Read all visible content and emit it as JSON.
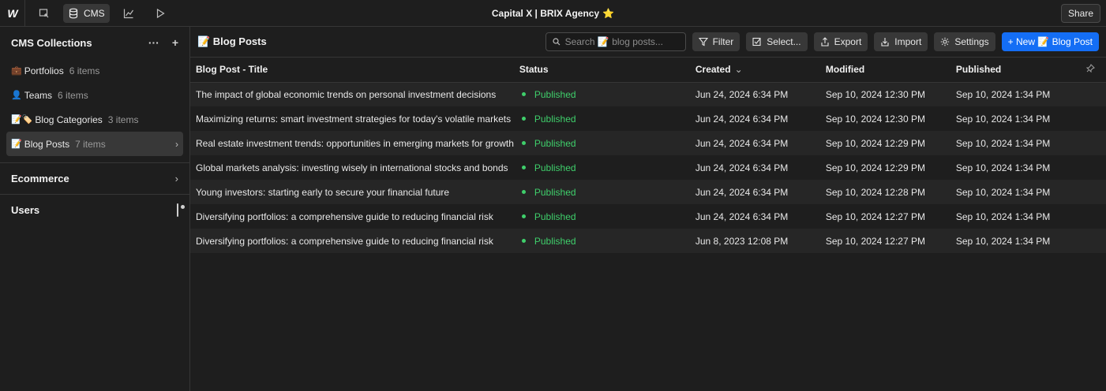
{
  "topbar": {
    "logo": "W",
    "cms_label": "CMS",
    "site_title": "Capital X | BRIX Agency",
    "star": "⭐",
    "share_label": "Share"
  },
  "sidebar": {
    "title": "CMS Collections",
    "more_glyph": "···",
    "add_glyph": "+",
    "collections": [
      {
        "emoji": "💼",
        "name": "Portfolios",
        "count": "6 items"
      },
      {
        "emoji": "👤",
        "name": "Teams",
        "count": "6 items"
      },
      {
        "emoji": "📝🏷️",
        "name": "Blog Categories",
        "count": "3 items"
      },
      {
        "emoji": "📝",
        "name": "Blog Posts",
        "count": "7 items"
      }
    ],
    "ecommerce_label": "Ecommerce",
    "users_label": "Users"
  },
  "main": {
    "title": "📝 Blog Posts",
    "search_placeholder": "Search 📝 blog posts...",
    "filter_label": "Filter",
    "select_label": "Select...",
    "export_label": "Export",
    "import_label": "Import",
    "settings_label": "Settings",
    "new_label": "+ New 📝 Blog Post"
  },
  "table": {
    "columns": [
      "Blog Post - Title",
      "Status",
      "Created",
      "Modified",
      "Published"
    ],
    "rows": [
      {
        "title": "The impact of global economic trends on personal investment decisions",
        "status": "Published",
        "created": "Jun 24, 2024 6:34 PM",
        "modified": "Sep 10, 2024 12:30 PM",
        "published": "Sep 10, 2024 1:34 PM"
      },
      {
        "title": "Maximizing returns: smart investment strategies for today's volatile markets",
        "status": "Published",
        "created": "Jun 24, 2024 6:34 PM",
        "modified": "Sep 10, 2024 12:30 PM",
        "published": "Sep 10, 2024 1:34 PM"
      },
      {
        "title": "Real estate investment trends: opportunities in emerging markets for growth",
        "status": "Published",
        "created": "Jun 24, 2024 6:34 PM",
        "modified": "Sep 10, 2024 12:29 PM",
        "published": "Sep 10, 2024 1:34 PM"
      },
      {
        "title": "Global markets analysis: investing wisely in international stocks and bonds",
        "status": "Published",
        "created": "Jun 24, 2024 6:34 PM",
        "modified": "Sep 10, 2024 12:29 PM",
        "published": "Sep 10, 2024 1:34 PM"
      },
      {
        "title": "Young investors: starting early to secure your financial future",
        "status": "Published",
        "created": "Jun 24, 2024 6:34 PM",
        "modified": "Sep 10, 2024 12:28 PM",
        "published": "Sep 10, 2024 1:34 PM"
      },
      {
        "title": "Diversifying portfolios: a comprehensive guide to reducing financial risk",
        "status": "Published",
        "created": "Jun 24, 2024 6:34 PM",
        "modified": "Sep 10, 2024 12:27 PM",
        "published": "Sep 10, 2024 1:34 PM"
      },
      {
        "title": "Diversifying portfolios: a comprehensive guide to reducing financial risk",
        "status": "Published",
        "created": "Jun 8, 2023 12:08 PM",
        "modified": "Sep 10, 2024 12:27 PM",
        "published": "Sep 10, 2024 1:34 PM"
      }
    ]
  },
  "colors": {
    "accent": "#146ef5",
    "published_status": "#3fcf6b",
    "background": "#1e1e1e"
  }
}
